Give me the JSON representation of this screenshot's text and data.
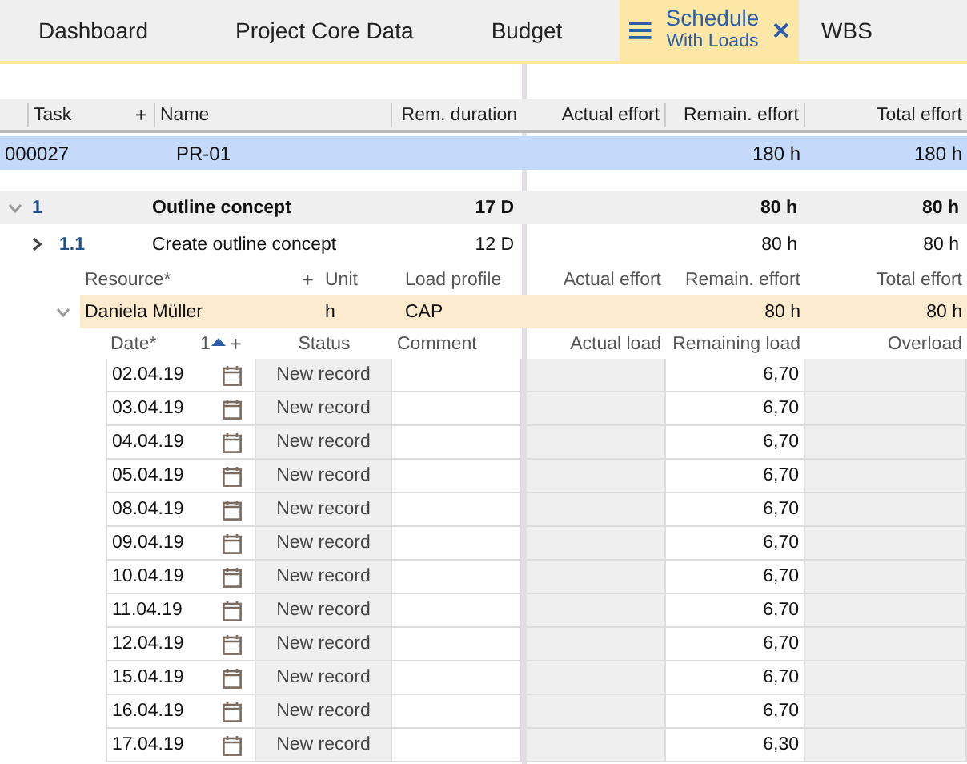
{
  "tabs": [
    {
      "label": "Dashboard",
      "selected": false
    },
    {
      "label": "Project Core Data",
      "selected": false
    },
    {
      "label": "Budget",
      "selected": false
    },
    {
      "label": "Schedule",
      "subtitle": "With Loads",
      "selected": true
    },
    {
      "label": "WBS",
      "selected": false
    }
  ],
  "table": {
    "columns": [
      {
        "label": "Task",
        "add": "+"
      },
      {
        "label": "Name"
      },
      {
        "label": "Rem. duration"
      },
      {
        "label": "Actual effort"
      },
      {
        "label": "Remain. effort"
      },
      {
        "label": "Total effort"
      }
    ],
    "project": {
      "task": "000027",
      "name": "PR-01",
      "remain_effort": "180 h",
      "total_effort": "180 h"
    },
    "tasks": [
      {
        "number": "1",
        "name": "Outline concept",
        "rem_duration": "17 D",
        "remain_effort": "80 h",
        "total_effort": "80 h",
        "expanded": true,
        "children": [
          {
            "number": "1.1",
            "name": "Create outline concept",
            "rem_duration": "12 D",
            "remain_effort": "80 h",
            "total_effort": "80 h",
            "expanded": false
          }
        ]
      }
    ]
  },
  "resources": {
    "columns": [
      {
        "label": "Resource*",
        "add": "+"
      },
      {
        "label": "Unit"
      },
      {
        "label": "Load profile"
      },
      {
        "label": "Actual effort"
      },
      {
        "label": "Remain. effort"
      },
      {
        "label": "Total effort"
      }
    ],
    "rows": [
      {
        "resource": "Daniela Müller",
        "unit": "h",
        "load_profile": "CAP",
        "remain_effort": "80 h",
        "total_effort": "80 h",
        "expanded": true
      }
    ]
  },
  "loads": {
    "columns": [
      {
        "label": "Date*",
        "sort_order": "1",
        "add": "+"
      },
      {
        "label": "Status"
      },
      {
        "label": "Comment"
      },
      {
        "label": "Actual load"
      },
      {
        "label": "Remaining load"
      },
      {
        "label": "Overload"
      }
    ],
    "rows": [
      {
        "date": "02.04.19",
        "status": "New record",
        "remaining_load": "6,70"
      },
      {
        "date": "03.04.19",
        "status": "New record",
        "remaining_load": "6,70"
      },
      {
        "date": "04.04.19",
        "status": "New record",
        "remaining_load": "6,70"
      },
      {
        "date": "05.04.19",
        "status": "New record",
        "remaining_load": "6,70"
      },
      {
        "date": "08.04.19",
        "status": "New record",
        "remaining_load": "6,70"
      },
      {
        "date": "09.04.19",
        "status": "New record",
        "remaining_load": "6,70"
      },
      {
        "date": "10.04.19",
        "status": "New record",
        "remaining_load": "6,70"
      },
      {
        "date": "11.04.19",
        "status": "New record",
        "remaining_load": "6,70"
      },
      {
        "date": "12.04.19",
        "status": "New record",
        "remaining_load": "6,70"
      },
      {
        "date": "15.04.19",
        "status": "New record",
        "remaining_load": "6,70"
      },
      {
        "date": "16.04.19",
        "status": "New record",
        "remaining_load": "6,70"
      },
      {
        "date": "17.04.19",
        "status": "New record",
        "remaining_load": "6,30"
      }
    ]
  }
}
